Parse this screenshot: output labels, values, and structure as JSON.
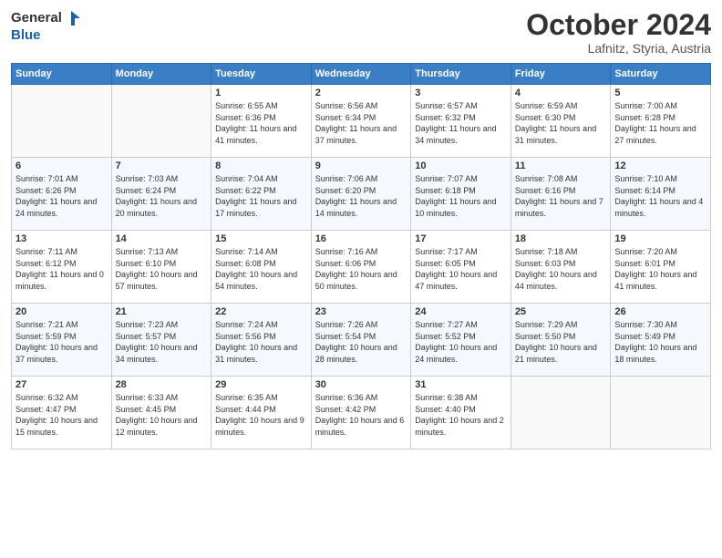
{
  "header": {
    "logo_general": "General",
    "logo_blue": "Blue",
    "month_title": "October 2024",
    "subtitle": "Lafnitz, Styria, Austria"
  },
  "days_of_week": [
    "Sunday",
    "Monday",
    "Tuesday",
    "Wednesday",
    "Thursday",
    "Friday",
    "Saturday"
  ],
  "weeks": [
    [
      {
        "day": "",
        "info": ""
      },
      {
        "day": "",
        "info": ""
      },
      {
        "day": "1",
        "info": "Sunrise: 6:55 AM\nSunset: 6:36 PM\nDaylight: 11 hours and 41 minutes."
      },
      {
        "day": "2",
        "info": "Sunrise: 6:56 AM\nSunset: 6:34 PM\nDaylight: 11 hours and 37 minutes."
      },
      {
        "day": "3",
        "info": "Sunrise: 6:57 AM\nSunset: 6:32 PM\nDaylight: 11 hours and 34 minutes."
      },
      {
        "day": "4",
        "info": "Sunrise: 6:59 AM\nSunset: 6:30 PM\nDaylight: 11 hours and 31 minutes."
      },
      {
        "day": "5",
        "info": "Sunrise: 7:00 AM\nSunset: 6:28 PM\nDaylight: 11 hours and 27 minutes."
      }
    ],
    [
      {
        "day": "6",
        "info": "Sunrise: 7:01 AM\nSunset: 6:26 PM\nDaylight: 11 hours and 24 minutes."
      },
      {
        "day": "7",
        "info": "Sunrise: 7:03 AM\nSunset: 6:24 PM\nDaylight: 11 hours and 20 minutes."
      },
      {
        "day": "8",
        "info": "Sunrise: 7:04 AM\nSunset: 6:22 PM\nDaylight: 11 hours and 17 minutes."
      },
      {
        "day": "9",
        "info": "Sunrise: 7:06 AM\nSunset: 6:20 PM\nDaylight: 11 hours and 14 minutes."
      },
      {
        "day": "10",
        "info": "Sunrise: 7:07 AM\nSunset: 6:18 PM\nDaylight: 11 hours and 10 minutes."
      },
      {
        "day": "11",
        "info": "Sunrise: 7:08 AM\nSunset: 6:16 PM\nDaylight: 11 hours and 7 minutes."
      },
      {
        "day": "12",
        "info": "Sunrise: 7:10 AM\nSunset: 6:14 PM\nDaylight: 11 hours and 4 minutes."
      }
    ],
    [
      {
        "day": "13",
        "info": "Sunrise: 7:11 AM\nSunset: 6:12 PM\nDaylight: 11 hours and 0 minutes."
      },
      {
        "day": "14",
        "info": "Sunrise: 7:13 AM\nSunset: 6:10 PM\nDaylight: 10 hours and 57 minutes."
      },
      {
        "day": "15",
        "info": "Sunrise: 7:14 AM\nSunset: 6:08 PM\nDaylight: 10 hours and 54 minutes."
      },
      {
        "day": "16",
        "info": "Sunrise: 7:16 AM\nSunset: 6:06 PM\nDaylight: 10 hours and 50 minutes."
      },
      {
        "day": "17",
        "info": "Sunrise: 7:17 AM\nSunset: 6:05 PM\nDaylight: 10 hours and 47 minutes."
      },
      {
        "day": "18",
        "info": "Sunrise: 7:18 AM\nSunset: 6:03 PM\nDaylight: 10 hours and 44 minutes."
      },
      {
        "day": "19",
        "info": "Sunrise: 7:20 AM\nSunset: 6:01 PM\nDaylight: 10 hours and 41 minutes."
      }
    ],
    [
      {
        "day": "20",
        "info": "Sunrise: 7:21 AM\nSunset: 5:59 PM\nDaylight: 10 hours and 37 minutes."
      },
      {
        "day": "21",
        "info": "Sunrise: 7:23 AM\nSunset: 5:57 PM\nDaylight: 10 hours and 34 minutes."
      },
      {
        "day": "22",
        "info": "Sunrise: 7:24 AM\nSunset: 5:56 PM\nDaylight: 10 hours and 31 minutes."
      },
      {
        "day": "23",
        "info": "Sunrise: 7:26 AM\nSunset: 5:54 PM\nDaylight: 10 hours and 28 minutes."
      },
      {
        "day": "24",
        "info": "Sunrise: 7:27 AM\nSunset: 5:52 PM\nDaylight: 10 hours and 24 minutes."
      },
      {
        "day": "25",
        "info": "Sunrise: 7:29 AM\nSunset: 5:50 PM\nDaylight: 10 hours and 21 minutes."
      },
      {
        "day": "26",
        "info": "Sunrise: 7:30 AM\nSunset: 5:49 PM\nDaylight: 10 hours and 18 minutes."
      }
    ],
    [
      {
        "day": "27",
        "info": "Sunrise: 6:32 AM\nSunset: 4:47 PM\nDaylight: 10 hours and 15 minutes."
      },
      {
        "day": "28",
        "info": "Sunrise: 6:33 AM\nSunset: 4:45 PM\nDaylight: 10 hours and 12 minutes."
      },
      {
        "day": "29",
        "info": "Sunrise: 6:35 AM\nSunset: 4:44 PM\nDaylight: 10 hours and 9 minutes."
      },
      {
        "day": "30",
        "info": "Sunrise: 6:36 AM\nSunset: 4:42 PM\nDaylight: 10 hours and 6 minutes."
      },
      {
        "day": "31",
        "info": "Sunrise: 6:38 AM\nSunset: 4:40 PM\nDaylight: 10 hours and 2 minutes."
      },
      {
        "day": "",
        "info": ""
      },
      {
        "day": "",
        "info": ""
      }
    ]
  ]
}
